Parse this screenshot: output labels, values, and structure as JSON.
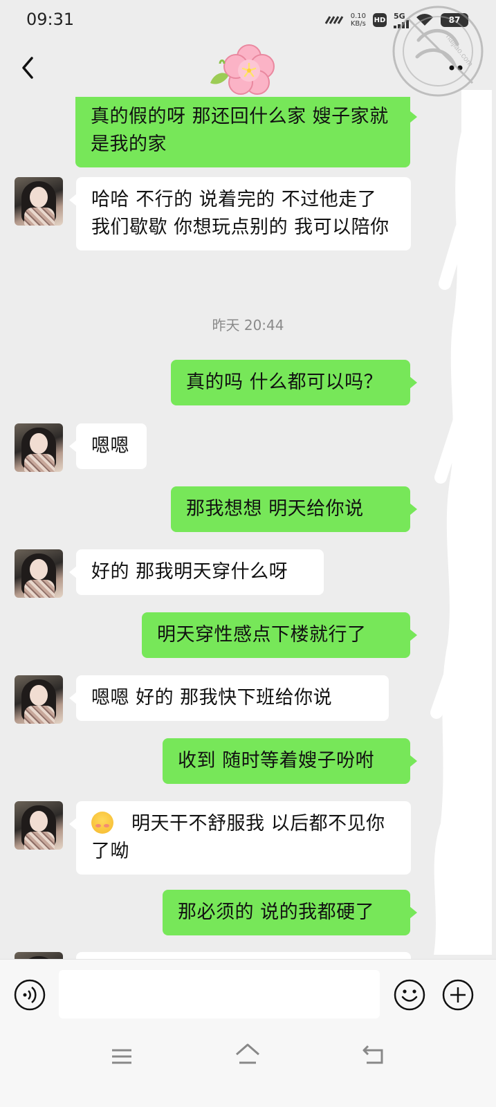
{
  "status_bar": {
    "time": "09:31",
    "net_speed_value": "0.10",
    "net_speed_unit": "KB/s",
    "hd_label": "HD",
    "network_type": "5G",
    "battery_level": "87"
  },
  "header": {
    "back_icon": "chevron-left-icon",
    "title_icon": "flower-icon",
    "more_icon": "more-icon",
    "watermark_text": "haijiao.com"
  },
  "messages": [
    {
      "side": "right",
      "text": "真的假的呀  那还回什么家  嫂子家就是我的家"
    },
    {
      "side": "left",
      "text": "哈哈  不行的  说着完的 不过他走了  我们歇歇  你想玩点别的  我可以陪你"
    },
    {
      "type": "time",
      "text": "昨天 20:44"
    },
    {
      "side": "right",
      "text": "真的吗  什么都可以吗？"
    },
    {
      "side": "left",
      "text": "嗯嗯"
    },
    {
      "side": "right",
      "text": "那我想想  明天给你说"
    },
    {
      "side": "left",
      "text": "好的  那我明天穿什么呀"
    },
    {
      "side": "right",
      "text": "明天穿性感点下楼就行了"
    },
    {
      "side": "left",
      "text": "嗯嗯  好的  那我快下班给你说"
    },
    {
      "side": "right",
      "text": "收到  随时等着嫂子吩咐"
    },
    {
      "side": "left",
      "emoji": "blushing-face-icon",
      "text": "明天干不舒服我  以后都不见你了呦"
    },
    {
      "side": "right",
      "text": "那必须的  说的我都硬了"
    }
  ],
  "input_bar": {
    "voice_icon": "voice-icon",
    "text_value": "",
    "emoji_icon": "smiley-icon",
    "plus_icon": "plus-icon"
  },
  "system_nav": {
    "menu_icon": "menu-icon",
    "home_icon": "home-icon",
    "back_icon": "back-icon"
  },
  "colors": {
    "background": "#ededed",
    "bubble_self": "#77e759",
    "bubble_other": "#ffffff",
    "time_text": "#8a8a8a"
  }
}
